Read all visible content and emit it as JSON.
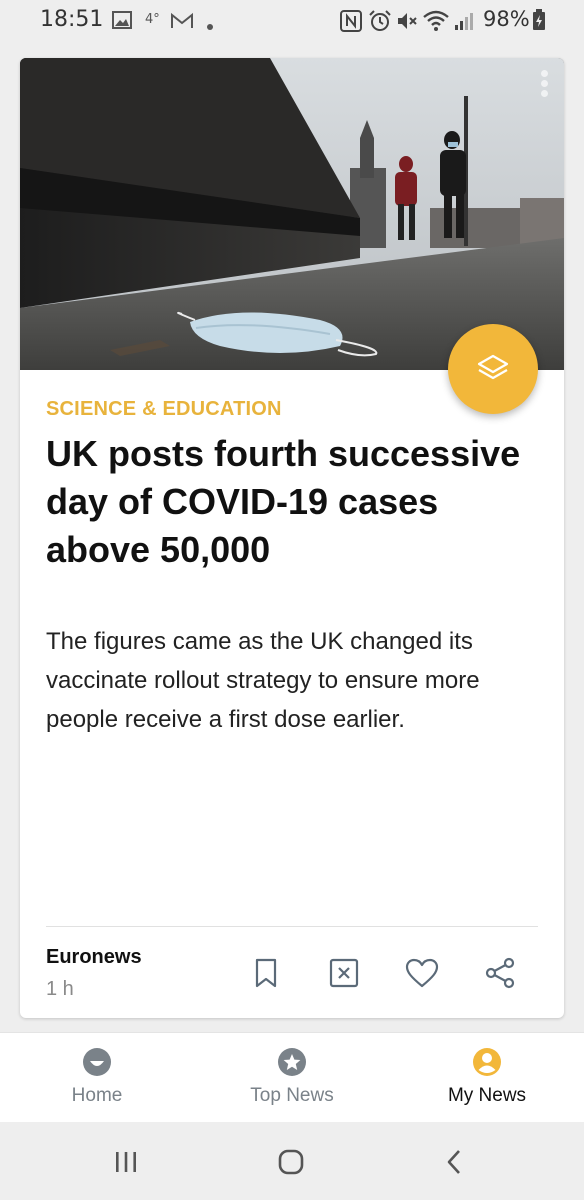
{
  "status_bar": {
    "time": "18:51",
    "temperature": "4°",
    "battery": "98%",
    "icons": [
      "image-icon",
      "mail-icon",
      "dot-icon",
      "nfc-icon",
      "alarm-icon",
      "mute-icon",
      "wifi-icon",
      "signal-icon",
      "battery-icon"
    ]
  },
  "article": {
    "category": "SCIENCE & EDUCATION",
    "headline": "UK posts fourth successive day of COVID-19 cases above 50,000",
    "summary": "The figures came as the UK changed its vaccinate rollout strategy to ensure more people receive a first dose earlier.",
    "source": "Euronews",
    "age": "1 h",
    "actions": [
      "bookmark-icon",
      "dismiss-icon",
      "heart-icon",
      "share-icon"
    ]
  },
  "bottom_nav": {
    "items": [
      {
        "label": "Home",
        "icon": "home-face-icon",
        "active": false
      },
      {
        "label": "Top News",
        "icon": "star-icon",
        "active": false
      },
      {
        "label": "My News",
        "icon": "person-icon",
        "active": true
      }
    ]
  },
  "colors": {
    "accent": "#f2b73a",
    "category": "#e8b33c",
    "nav_inactive": "#7a8289"
  }
}
